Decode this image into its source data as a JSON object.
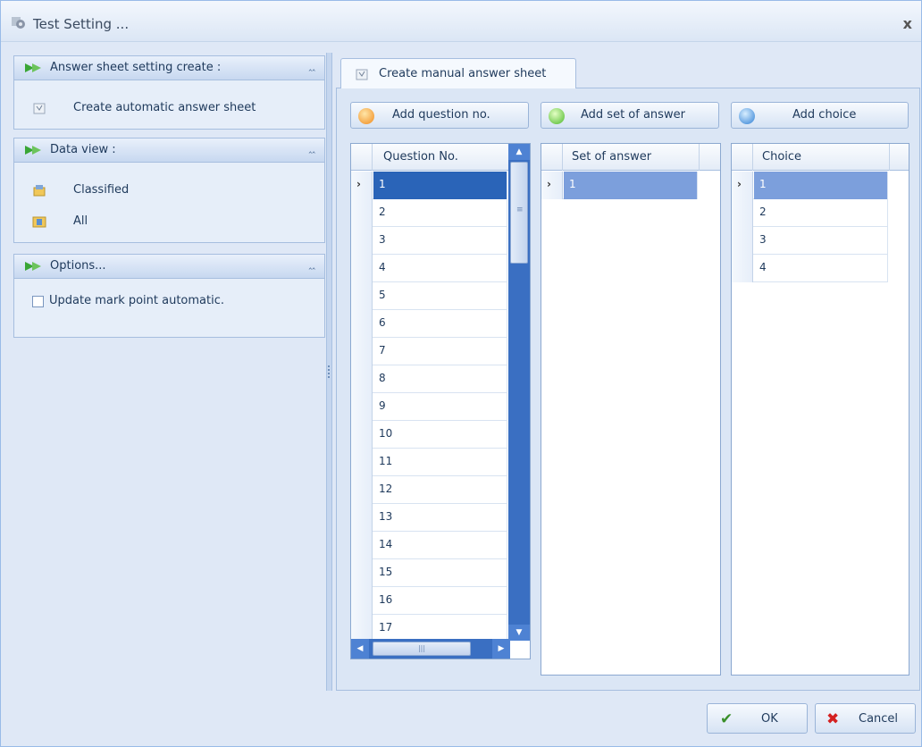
{
  "window": {
    "title": "Test Setting ...",
    "close": "x"
  },
  "nav": {
    "groups": [
      {
        "label": "Answer sheet setting create :",
        "items": [
          "Create automatic answer sheet"
        ]
      },
      {
        "label": "Data view :",
        "items": [
          "Classified",
          "All"
        ]
      },
      {
        "label": "Options...",
        "checkbox": {
          "label": "Update mark point automatic.",
          "checked": false
        }
      }
    ]
  },
  "tab": {
    "label": "Create manual answer sheet"
  },
  "buttons": {
    "add_question": "Add question no.",
    "add_set": "Add set of answer",
    "add_choice": "Add choice"
  },
  "grids": {
    "question": {
      "header": "Question No.",
      "rows": [
        "1",
        "2",
        "3",
        "4",
        "5",
        "6",
        "7",
        "8",
        "9",
        "10",
        "11",
        "12",
        "13",
        "14",
        "15",
        "16",
        "17"
      ]
    },
    "set": {
      "header": "Set of answer",
      "rows": [
        "1"
      ]
    },
    "choice": {
      "header": "Choice",
      "rows": [
        "1",
        "2",
        "3",
        "4"
      ]
    }
  },
  "footer": {
    "ok": "OK",
    "cancel": "Cancel"
  },
  "colors": {
    "selection": "#2a64b8",
    "selection_inactive": "#7c9fdc",
    "ok_check": "#3a8f2a",
    "cancel_x": "#d42020"
  }
}
